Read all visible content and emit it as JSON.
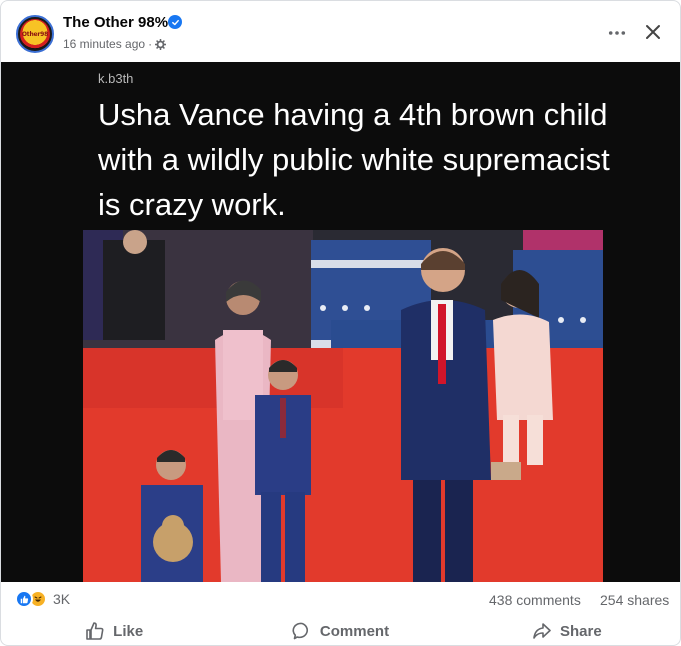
{
  "post": {
    "page_name": "The Other 98%",
    "timestamp": "16 minutes ago",
    "meta_separator": "·",
    "avatar_text": "Other98",
    "image": {
      "username": "k.b3th",
      "headline": "Usha Vance having a 4th brown child with a wildly public white supremacist is crazy work."
    },
    "stats": {
      "reaction_count": "3K",
      "comments": "438 comments",
      "shares": "254 shares"
    },
    "actions": {
      "like": "Like",
      "comment": "Comment",
      "share": "Share"
    }
  },
  "icons": {
    "verified": "verified-badge-icon",
    "privacy": "gear-icon",
    "more": "more-options-icon",
    "close": "close-icon",
    "like_reaction": "thumbs-up-icon",
    "haha_reaction": "haha-face-icon"
  },
  "colors": {
    "brand_blue": "#1877f2",
    "text_secondary": "#65676b",
    "haha_yellow": "#f7b125"
  }
}
